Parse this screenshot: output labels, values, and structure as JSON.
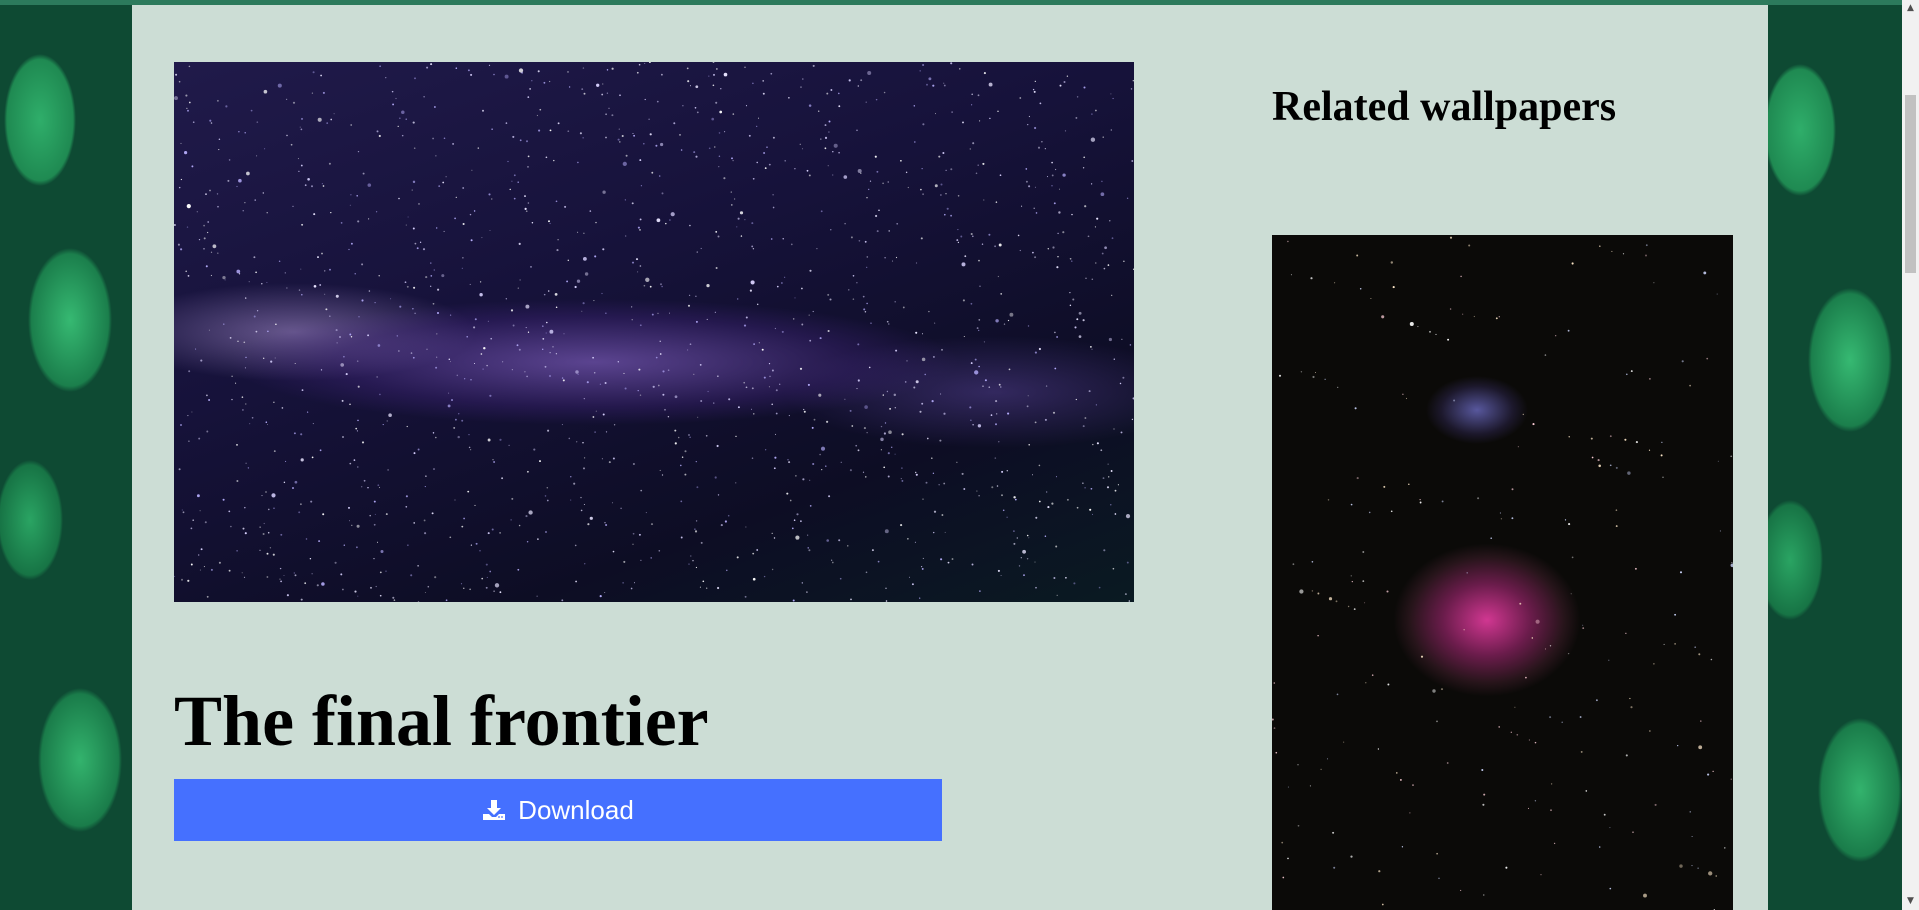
{
  "wallpaper": {
    "title": "The final frontier",
    "image_alt": "Milky Way starry night sky",
    "download_label": "Download"
  },
  "related": {
    "heading": "Related wallpapers",
    "items": [
      {
        "image_alt": "Orion Nebula"
      }
    ]
  },
  "icons": {
    "download": "download-icon",
    "scroll_up": "scroll-up-arrow-icon",
    "scroll_down": "scroll-down-arrow-icon"
  },
  "colors": {
    "page_background": "#ccddd5",
    "top_bar": "#2c7a5c",
    "download_button": "#4570ff",
    "download_text": "#ffffff"
  }
}
